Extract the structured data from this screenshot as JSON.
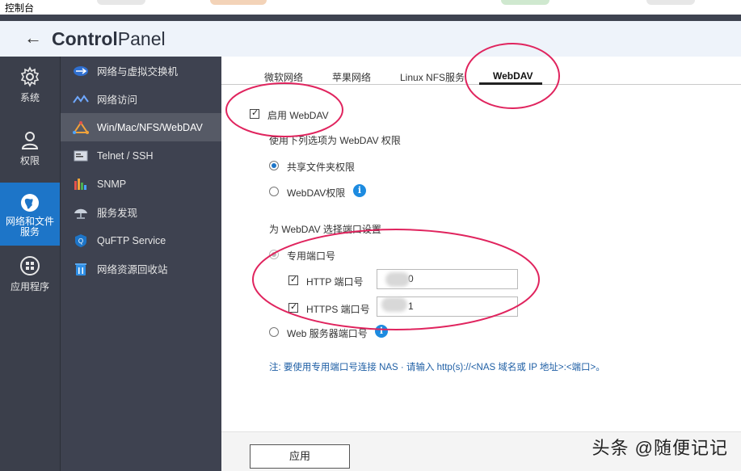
{
  "window": {
    "title": "控制台"
  },
  "header": {
    "back_glyph": "←",
    "brand_bold": "Control",
    "brand_light": "Panel"
  },
  "leftnav": [
    {
      "label": "系统",
      "icon": "gear-icon"
    },
    {
      "label": "权限",
      "icon": "user-icon"
    },
    {
      "label": "网络和文件服务",
      "label_line1": "网络和文件",
      "label_line2": "服务",
      "icon": "globe-icon",
      "active": true
    },
    {
      "label": "应用程序",
      "icon": "apps-icon"
    }
  ],
  "subnav": [
    {
      "label": "网络与虚拟交换机",
      "icon": "network-switch-icon"
    },
    {
      "label": "网络访问",
      "icon": "network-access-icon"
    },
    {
      "label": "Win/Mac/NFS/WebDAV",
      "icon": "triangle-share-icon",
      "active": true
    },
    {
      "label": "Telnet / SSH",
      "icon": "terminal-icon"
    },
    {
      "label": "SNMP",
      "icon": "bar-chart-icon"
    },
    {
      "label": "服务发现",
      "icon": "satellite-dish-icon"
    },
    {
      "label": "QuFTP Service",
      "icon": "ftp-icon"
    },
    {
      "label": "网络资源回收站",
      "icon": "recycle-bin-icon"
    }
  ],
  "tabs": [
    {
      "label": "微软网络"
    },
    {
      "label": "苹果网络"
    },
    {
      "label": "Linux NFS服务"
    },
    {
      "label": "WebDAV",
      "active": true
    }
  ],
  "webdav": {
    "enable_label": "启用 WebDAV",
    "enable_checked": true,
    "permission_heading": "使用下列选项为 WebDAV 权限",
    "perm_share_label": "共享文件夹权限",
    "perm_webdav_label": "WebDAV权限",
    "port_heading": "为 WebDAV 选择端口设置",
    "port_dedicated_label": "专用端口号",
    "http_label": "HTTP 端口号",
    "http_value": "0",
    "https_label": "HTTPS 端口号",
    "https_value": "1",
    "web_server_port_label": "Web 服务器端口号",
    "note": "注: 要使用专用端口号连接 NAS · 请输入 http(s)://<NAS 域名或 IP 地址>:<端口>。"
  },
  "footer": {
    "apply_label": "应用"
  },
  "watermark": "头条 @随便记记",
  "colors": {
    "accent": "#1d75c8",
    "annotation": "#e0245e",
    "sidebar_dark": "#3b3f4b"
  }
}
